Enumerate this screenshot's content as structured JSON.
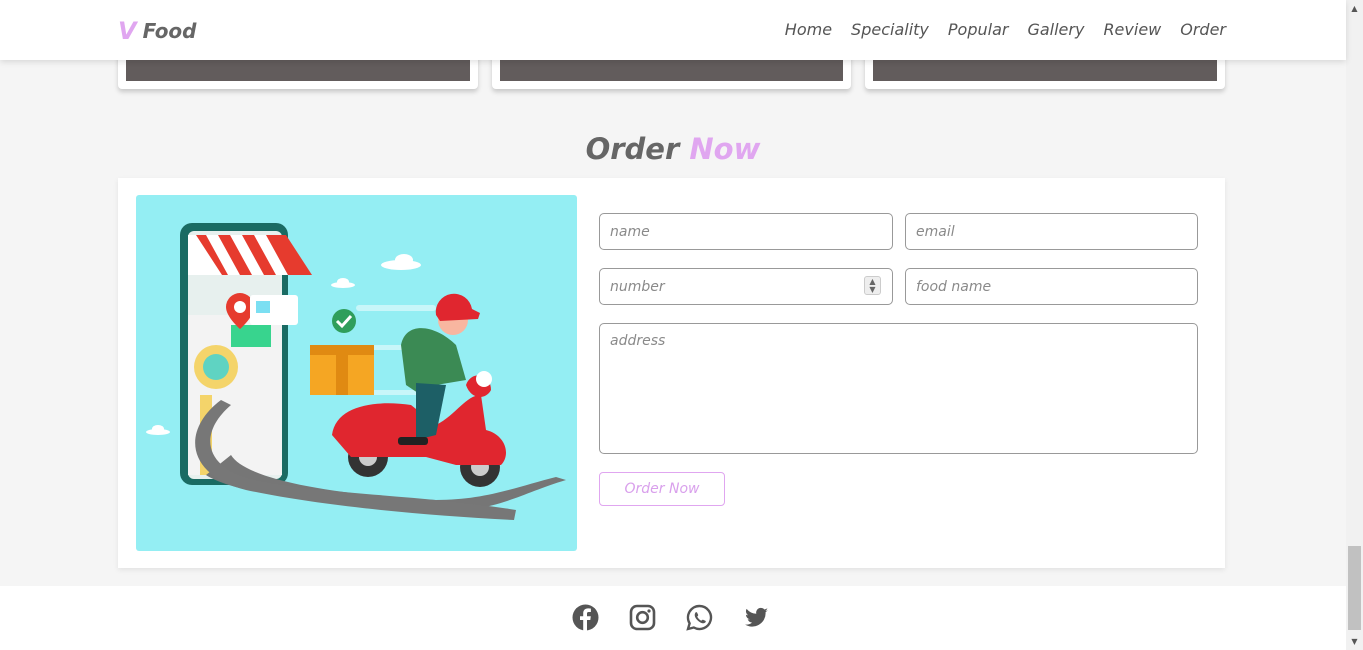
{
  "header": {
    "logo_mark": "V",
    "logo_text": "Food",
    "nav": [
      "Home",
      "Speciality",
      "Popular",
      "Gallery",
      "Review",
      "Order"
    ]
  },
  "section": {
    "heading_main": "Order",
    "heading_accent": "Now"
  },
  "form": {
    "name_placeholder": "name",
    "email_placeholder": "email",
    "number_placeholder": "number",
    "food_placeholder": "food name",
    "address_placeholder": "address",
    "submit_label": "Order Now"
  },
  "footer": {
    "socials": [
      "facebook-icon",
      "instagram-icon",
      "whatsapp-icon",
      "twitter-icon"
    ]
  },
  "colors": {
    "accent": "#e0a6f0",
    "text": "#666666",
    "illustration_bg": "#94eef3",
    "card_image": "#625c5c"
  }
}
